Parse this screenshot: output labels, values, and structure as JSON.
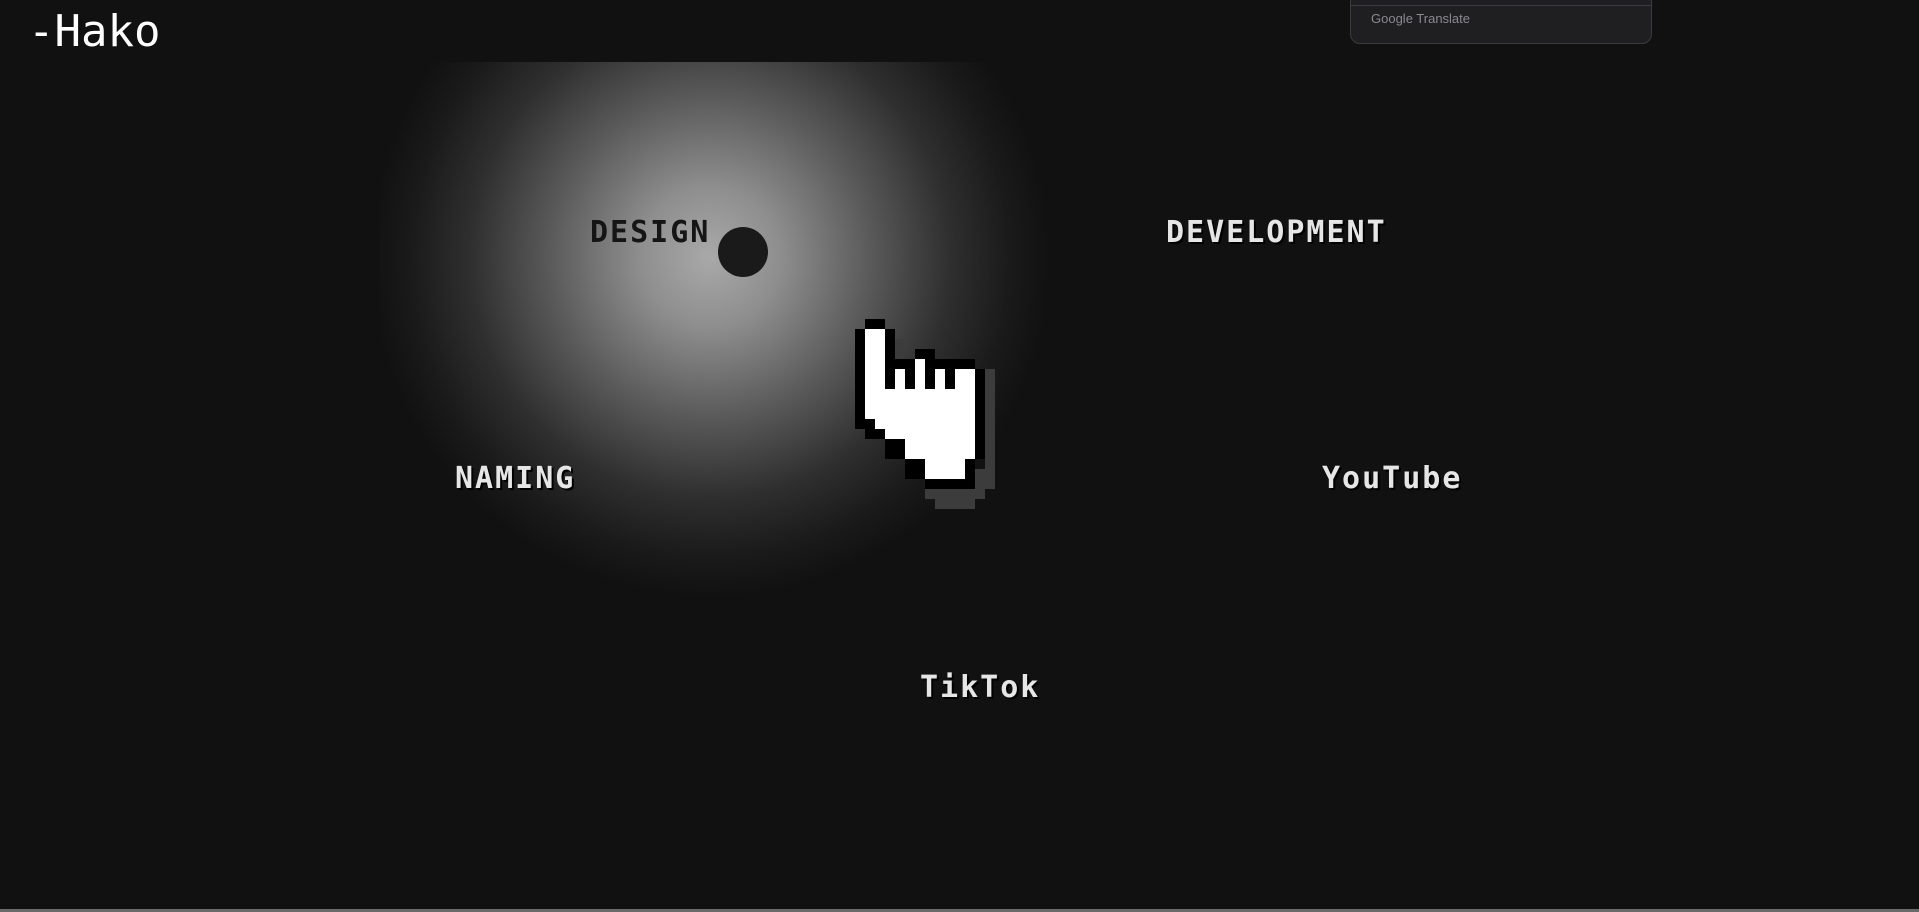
{
  "header": {
    "logo": "-Hako"
  },
  "nav": {
    "design": "DESIGN",
    "development": "DEVELOPMENT",
    "naming": "NAMING",
    "youtube": "YouTube",
    "tiktok": "TikTok"
  },
  "translate_popup": {
    "brand": "Google Translate"
  },
  "icons": {
    "cursor": "pixel-hand-pointer-icon"
  },
  "colors": {
    "background": "#111111",
    "link": "#e6e6e6",
    "spotlight": "#a9a9a9"
  }
}
